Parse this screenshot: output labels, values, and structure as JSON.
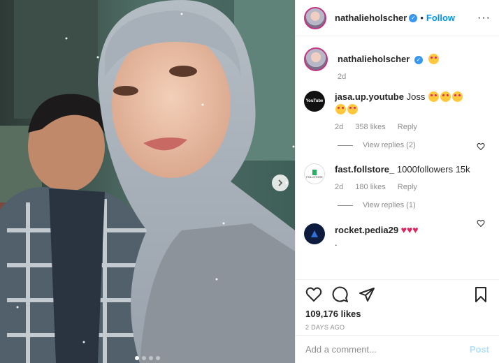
{
  "colors": {
    "accent": "#0095f6",
    "verified": "#3897f0",
    "muted": "#8e8e8e",
    "text": "#262626"
  },
  "header": {
    "username": "nathalieholscher",
    "follow_label": "Follow",
    "more_label": "···"
  },
  "media": {
    "carousel": {
      "total_slides": 4,
      "active_index": 0
    }
  },
  "caption": {
    "username": "nathalieholscher",
    "time": "2d"
  },
  "comments": [
    {
      "username": "jasa.up.youtube",
      "text": "Joss",
      "time": "2d",
      "likes": "358 likes",
      "reply_label": "Reply",
      "view_replies": "View replies (2)",
      "avatar_text": "YouTube"
    },
    {
      "username": "fast.follstore_",
      "text": "1000followers 15k",
      "time": "2d",
      "likes": "180 likes",
      "reply_label": "Reply",
      "view_replies": "View replies (1)",
      "avatar_text": "FOLLSTORE"
    },
    {
      "username": "rocket.pedia29",
      "text": "."
    }
  ],
  "actions": {
    "likes": "109,176 likes",
    "date": "2 DAYS AGO"
  },
  "add_comment": {
    "placeholder": "Add a comment...",
    "post_label": "Post"
  }
}
